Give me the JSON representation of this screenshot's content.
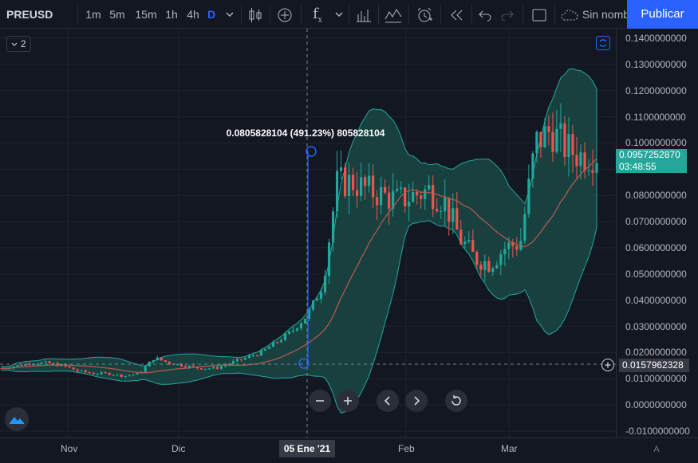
{
  "toolbar": {
    "symbol": "PREUSD",
    "intervals": [
      "1m",
      "5m",
      "15m",
      "1h",
      "4h",
      "D"
    ],
    "active_interval": "D",
    "fx_label": "f",
    "fx_sub": "x",
    "layout_name": "Sin nomb",
    "publish_label": "Publicar"
  },
  "legend": {
    "count": "2"
  },
  "measure_label": "0.0805828104 (491.23%) 805828104",
  "price_ticks": [
    "0.1400000000",
    "0.1300000000",
    "0.1200000000",
    "0.1100000000",
    "0.1000000000",
    "0.0900000000",
    "0.0800000000",
    "0.0700000000",
    "0.0600000000",
    "0.0500000000",
    "0.0400000000",
    "0.0300000000",
    "0.0200000000",
    "0.0100000000",
    "0.0000000000",
    "-0.0100000000"
  ],
  "last_price": {
    "value": "0.0957252870",
    "countdown": "03:48:55",
    "color": "#26a69a"
  },
  "crosshair_price": "0.0157962328",
  "time_ticks": [
    "Nov",
    "Dic",
    "Feb",
    "Mar"
  ],
  "crosshair_time": "05 Ene '21",
  "scale_mode": "A",
  "colors": {
    "up": "#26a69a",
    "down": "#ef5350",
    "band": "#1a4f4a",
    "basis": "#b05a50",
    "accent": "#2962ff"
  },
  "chart_data": {
    "type": "candlestick",
    "ylim": [
      -0.01,
      0.14
    ],
    "x_range": [
      "Oct '20",
      "Mar '21"
    ],
    "close_path": [
      0.014,
      0.015,
      0.016,
      0.016,
      0.015,
      0.013,
      0.012,
      0.012,
      0.011,
      0.012,
      0.018,
      0.016,
      0.015,
      0.014,
      0.014,
      0.016,
      0.018,
      0.02,
      0.024,
      0.028,
      0.034,
      0.045,
      0.085,
      0.085,
      0.082,
      0.08,
      0.078,
      0.08,
      0.082,
      0.078,
      0.064,
      0.056,
      0.054,
      0.06,
      0.062,
      0.1,
      0.105,
      0.098,
      0.095,
      0.096
    ]
  }
}
